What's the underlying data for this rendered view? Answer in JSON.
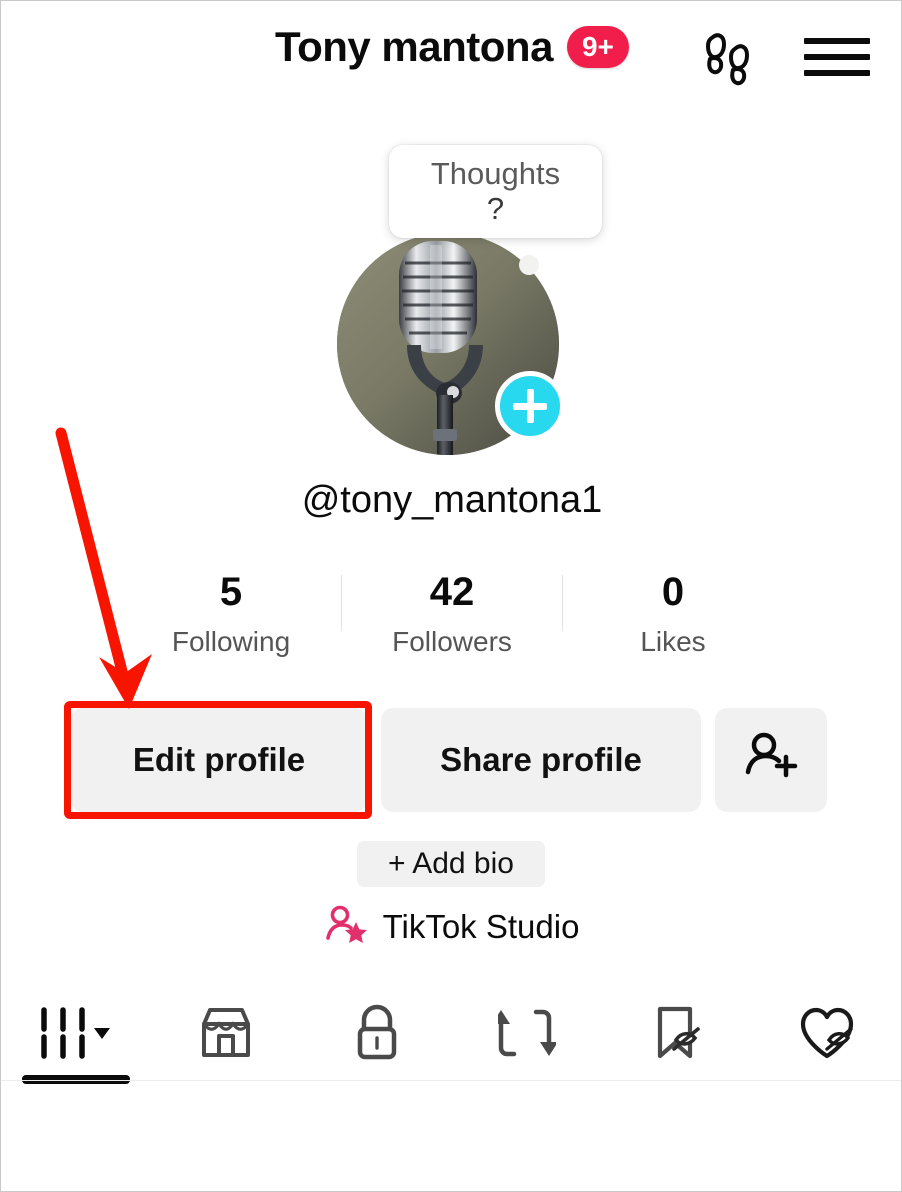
{
  "app": {
    "name": "TikTok",
    "screen": "profile"
  },
  "header": {
    "title": "Tony mantona",
    "badge": "9+",
    "footprints_icon": "footprints-icon",
    "menu_icon": "hamburger-menu-icon"
  },
  "thoughts": {
    "line1": "Thoughts",
    "line2": "?"
  },
  "avatar": {
    "alt": "vintage-microphone-photo",
    "add_icon": "plus-icon"
  },
  "profile": {
    "username": "@tony_mantona1"
  },
  "stats": [
    {
      "value": "5",
      "label": "Following",
      "name": "following"
    },
    {
      "value": "42",
      "label": "Followers",
      "name": "followers"
    },
    {
      "value": "0",
      "label": "Likes",
      "name": "likes"
    }
  ],
  "actions": {
    "edit_profile": "Edit profile",
    "share_profile": "Share profile",
    "add_friend_icon": "add-person-icon"
  },
  "bio": {
    "add_bio": "+ Add bio"
  },
  "studio": {
    "label": "TikTok Studio",
    "icon": "person-star-icon"
  },
  "tabs": [
    {
      "name": "videos",
      "icon": "grid-dropdown-icon",
      "active": true
    },
    {
      "name": "shop",
      "icon": "storefront-icon",
      "active": false
    },
    {
      "name": "private",
      "icon": "lock-icon",
      "active": false
    },
    {
      "name": "reposts",
      "icon": "repost-arrows-icon",
      "active": false
    },
    {
      "name": "saved",
      "icon": "bookmark-slash-icon",
      "active": false
    },
    {
      "name": "liked",
      "icon": "heart-slash-icon",
      "active": false
    }
  ],
  "annotation": {
    "type": "red-highlight-arrow",
    "target": "Edit profile",
    "color": "#f71500"
  },
  "colors": {
    "badge": "#f11e4c",
    "add_button": "#27d8ef",
    "button_bg": "#f1f1f1",
    "studio_icon": "#e1306c",
    "annotation": "#f71500"
  }
}
